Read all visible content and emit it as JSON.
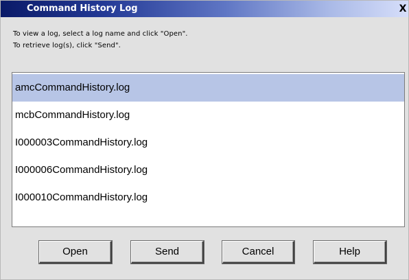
{
  "window": {
    "title": "Command History Log",
    "close_label": "X"
  },
  "instructions": {
    "line1": "To view a log, select a log name and click \"Open\".",
    "line2": "To retrieve log(s), click \"Send\"."
  },
  "log_list": {
    "items": [
      {
        "label": "amcCommandHistory.log",
        "selected": true
      },
      {
        "label": "mcbCommandHistory.log",
        "selected": false
      },
      {
        "label": "I000003CommandHistory.log",
        "selected": false
      },
      {
        "label": "I000006CommandHistory.log",
        "selected": false
      },
      {
        "label": "I000010CommandHistory.log",
        "selected": false
      }
    ]
  },
  "buttons": {
    "open_label": "Open",
    "send_label": "Send",
    "cancel_label": "Cancel",
    "help_label": "Help"
  },
  "colors": {
    "selection": "#b7c5e6",
    "title_start": "#0a1a68",
    "title_end": "#d6defa",
    "dialog_bg": "#e1e1e1"
  }
}
